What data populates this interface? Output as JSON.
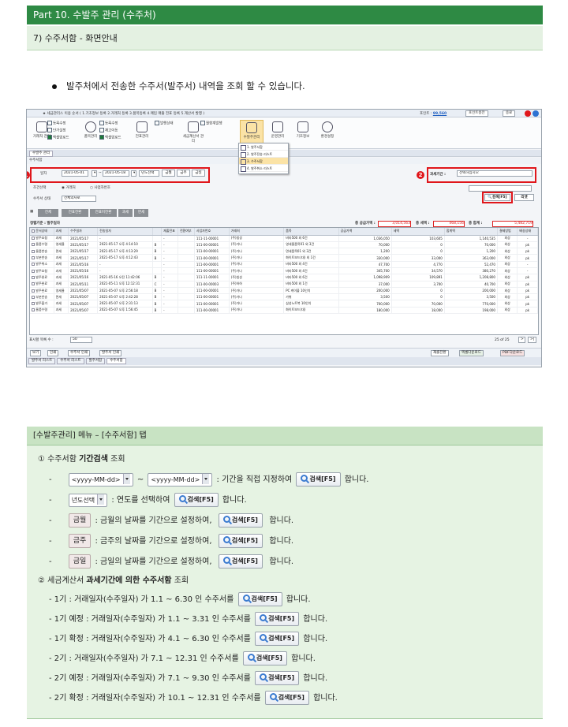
{
  "header": {
    "title": "Part 10. 수발주 관리 (수주처)",
    "subtitle": "7) 수주서함 - 화면안내"
  },
  "intro": "발주처에서 전송한 수주서(발주서) 내역을 조회 할 수 있습니다.",
  "shot": {
    "top_title": "★ 세금관리스 이용 순서 ( 1.기초정보 등록 2.거래처 등록 3.품목등록 4.매입 매출 전표 등록 5.계산서 발행 )",
    "points_label": "포인트 :",
    "points_value": "99,560",
    "btn_charge": "포인트충전",
    "btn_exit": "종료",
    "ribbon": [
      {
        "label": "거래처\n관리"
      },
      {
        "label": "품목관리"
      },
      {
        "label": "전표관리"
      },
      {
        "label": "세금계산서\n관리"
      },
      {
        "label": "수발주관리"
      },
      {
        "label": "운영관리"
      },
      {
        "label": "기초정보"
      },
      {
        "label": "환경설정"
      }
    ],
    "ribbon_small": [
      "등록수정",
      "단가설정",
      "엑셀업로드",
      "등록수정",
      "재고이동",
      "엑셀업로드",
      "발행상태",
      "월합계발행"
    ],
    "dropdown": [
      "1. 발주서함",
      "2. 발주전송 리스트",
      "3. 수주서함",
      "4. 발주취소 리스트"
    ],
    "tab_top": "수발주 관리",
    "section": "수주서함",
    "filter": {
      "date_label": "일자",
      "date_from": "2021-05-01",
      "date_to": "2021-05-18",
      "year_select": "년도선택",
      "btn_month": "금월",
      "btn_week": "금주",
      "btn_day": "금일",
      "cond_label": "조건선택",
      "radio1": "거래처",
      "radio2": "사업자번호",
      "status_label": "수주서 상태",
      "status_value": "전체의사로",
      "tax_label": "과세기간 :",
      "tax_value": "선택하십시오",
      "btn_search": "검색[F5]",
      "btn_reset": "리셋"
    },
    "gtabs": [
      "전체",
      "전표전환",
      "전표미전환",
      "과세",
      "면세"
    ],
    "sum": {
      "left": "정렬기준 : 발주일자",
      "supply_label": "총 공급가액 :",
      "supply": "3,014,563",
      "tax_label": "총 세액 :",
      "tax": "468,156",
      "total_label": "총 합계 :",
      "total": "5,482,719"
    },
    "columns": [
      "문서상태",
      "과세",
      "수주일자",
      "전송일자",
      "",
      "재출전표",
      "전환여부",
      "사업자번호",
      "거래처",
      "품목",
      "공급가액",
      "세액",
      "합계액",
      "결제방법",
      "배송상태"
    ],
    "rows": [
      [
        "발주요청",
        "과세",
        "2021/05/17",
        "-",
        "",
        "-",
        "",
        "111-11-00001",
        "(주)칭성",
        "비타500 외 6건",
        "1,036,050",
        "103,605",
        "1,140,535",
        "외상",
        "-"
      ],
      [
        "물품수령",
        "영세율",
        "2021/05/17",
        "2021-05-17 오후 4:14:10",
        "B",
        "-",
        "",
        "111-00-00001",
        "(주)가나",
        "영세율품목01 외 3건",
        "70,000",
        "0",
        "70,000",
        "외상",
        "pk"
      ],
      [
        "물품반송",
        "면세",
        "2021/05/17",
        "2021-05-17 오후 4:13:29",
        "B",
        "-",
        "",
        "111-00-00001",
        "(주)가나",
        "면세품목01 외 3건",
        "1,200",
        "0",
        "1,200",
        "외상",
        "pk"
      ],
      [
        "부분반송",
        "과세",
        "2021/05/17",
        "2021-05-17 오후 4:12:43",
        "B",
        "-",
        "",
        "111-00-00001",
        "(주)가나",
        "화이트보드(대) 외 1건",
        "330,000",
        "33,000",
        "363,000",
        "외상",
        "pk"
      ],
      [
        "발주취소",
        "과세",
        "2021/05/16",
        "-",
        "",
        "-",
        "",
        "111-00-00001",
        "(주)가나",
        "비타500 외 4건",
        "47,700",
        "4,770",
        "52,470",
        "외상",
        "-"
      ],
      [
        "발주요청",
        "과세",
        "2021/05/16",
        "-",
        "",
        "-",
        "",
        "111-00-00001",
        "(주)가나",
        "비타500 외 4건",
        "345,700",
        "34,570",
        "380,270",
        "외상",
        "-"
      ],
      [
        "발주완료",
        "과세",
        "2021/05/16",
        "2021-05-16 오전 11:42:06",
        "B",
        "-",
        "",
        "111-11-00001",
        "(주)칭성",
        "비타500 외 6건",
        "1,098,909",
        "109,891",
        "1,208,800",
        "외상",
        "pk"
      ],
      [
        "발주완료",
        "과세",
        "2021/05/11",
        "2021-05-11 오후 12:12:31",
        "C",
        "-",
        "",
        "111-00-00003",
        "(주)하하",
        "비타500 외 1건",
        "37,000",
        "3,700",
        "40,700",
        "외상",
        "pk"
      ],
      [
        "발주완료",
        "영세율",
        "2021/05/07",
        "2021-05-07 오후 2:56:18",
        "B",
        "-",
        "",
        "111-00-00001",
        "(주)가나",
        "PC 케이블 10인치",
        "200,000",
        "0",
        "200,000",
        "외상",
        "pk"
      ],
      [
        "부분반송",
        "면세",
        "2021/05/07",
        "2021-05-07 오후 2:42:28",
        "B",
        "-",
        "",
        "111-00-00001",
        "(주)가나",
        "가위",
        "3,500",
        "0",
        "3,500",
        "외상",
        "pk"
      ],
      [
        "발주불가",
        "과세",
        "2021/05/07",
        "2021-05-07 오후 2:31:13",
        "B",
        "-",
        "",
        "111-00-00001",
        "(주)가나",
        "삼성노트북 10인치",
        "700,000",
        "70,000",
        "770,000",
        "외상",
        "pk"
      ],
      [
        "물품수령",
        "과세",
        "2021/05/07",
        "2021-05-07 오후 1:56:45",
        "B",
        "-",
        "",
        "111-00-00001",
        "(주)가나",
        "화이트보드(대)",
        "180,000",
        "18,000",
        "198,000",
        "외상",
        "pk"
      ]
    ],
    "foot": {
      "rows_label": "표시할 목록 수 :",
      "rows_value": "50",
      "page": "25 of 25"
    },
    "bottom_btns": [
      "보기",
      "인쇄",
      "수주서 인쇄",
      "발주서 인쇄"
    ],
    "bottom_right": [
      "재출전환",
      "엑셀다운로드",
      "PDF다운로드"
    ],
    "bottom_tabs": [
      "발주서 리스트",
      "수주서 리스트",
      "발주서함",
      "수주서함"
    ]
  },
  "section2": {
    "title": "[수발주관리] 메뉴 – [수주서함] 탭",
    "h1_num": "①",
    "h1_pre": "수주서함",
    "h1_bold": "기간검색",
    "h1_post": "조회",
    "date_placeholder": "<yyyy-MM-dd>",
    "tilde": "~",
    "l1_text": ": 기간을 직접 지정하여",
    "search_btn": "검색[F5]",
    "end_text": "합니다.",
    "year_select": "년도선택",
    "l2_text": ": 연도를 선택하여",
    "month": "금월",
    "l3_text": ": 금월의 날짜를 기간으로 설정하여,",
    "week": "금주",
    "l4_text": ": 금주의 날짜를 기간으로 설정하여,",
    "day": "금일",
    "l5_text": ": 금일의 날짜를 기간으로 설정하여,",
    "h2_num": "②",
    "h2_pre": "세금계산서",
    "h2_bold": "과세기간에 의한 수주서함",
    "h2_post": "조회",
    "periods": [
      "- 1기 : 거래일자(수주일자) 가 1.1 ~ 6.30 인 수주서를",
      "- 1기 예정 : 거래일자(수주일자) 가 1.1 ~ 3.31 인 수주서를",
      "- 1기 확정 : 거래일자(수주일자) 가 4.1 ~ 6.30 인 수주서를",
      "- 2기 : 거래일자(수주일자) 가 7.1 ~ 12.31 인 수주서를",
      "- 2기 예정 : 거래일자(수주일자) 가 7.1 ~ 9.30 인 수주서를",
      "- 2기 확정 : 거래일자(수주일자) 가 10.1 ~ 12.31 인 수주서를"
    ],
    "dash": "-"
  }
}
